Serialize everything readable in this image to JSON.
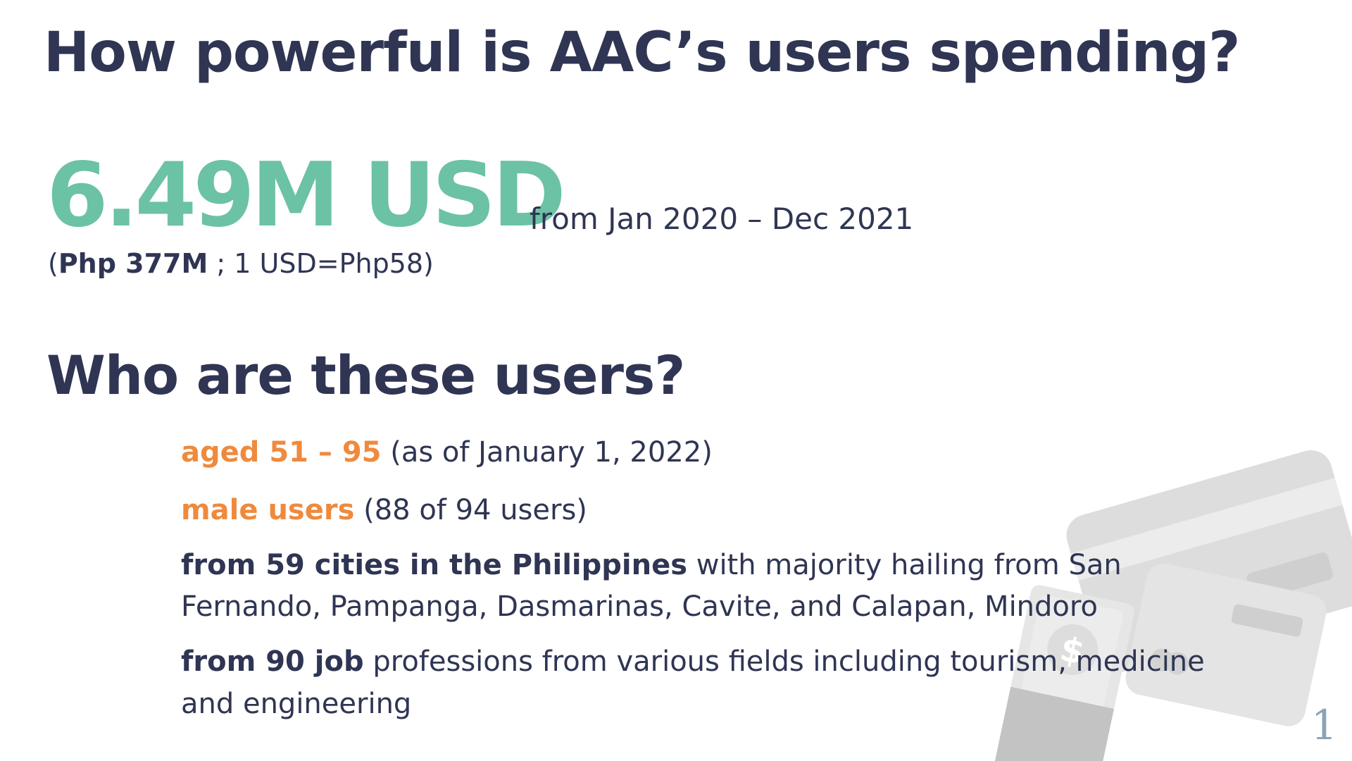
{
  "title": "How powerful is AAC’s users spending?",
  "headline": {
    "amount": "6.49M USD",
    "period": "from Jan 2020 – Dec 2021",
    "php_open": "(",
    "php_amount": "Php 377M",
    "php_rest": " ; 1 USD=Php58)"
  },
  "subtitle": "Who are these users?",
  "facts": [
    {
      "highlight": "aged 51 – 95",
      "rest": " (as of January 1, 2022)"
    },
    {
      "highlight": "male users",
      "rest": " (88 of 94 users)"
    },
    {
      "highlight": "from 59 cities in the Philippines",
      "rest": " with majority hailing from San",
      "line2": "Fernando, Pampanga, Dasmarinas, Cavite, and Calapan, Mindoro"
    },
    {
      "highlight": "from 90 job",
      "rest": " professions from various fields including tourism, medicine",
      "line2": "and engineering"
    }
  ],
  "illustration": {
    "icon": "money-and-cards-icon",
    "glyph": "$"
  },
  "page_number": "1",
  "colors": {
    "navy": "#2f3553",
    "teal": "#6cc2a4",
    "orange": "#ef8a3d",
    "gray": "#dcdcdc",
    "page_number": "#8aa3b8"
  }
}
